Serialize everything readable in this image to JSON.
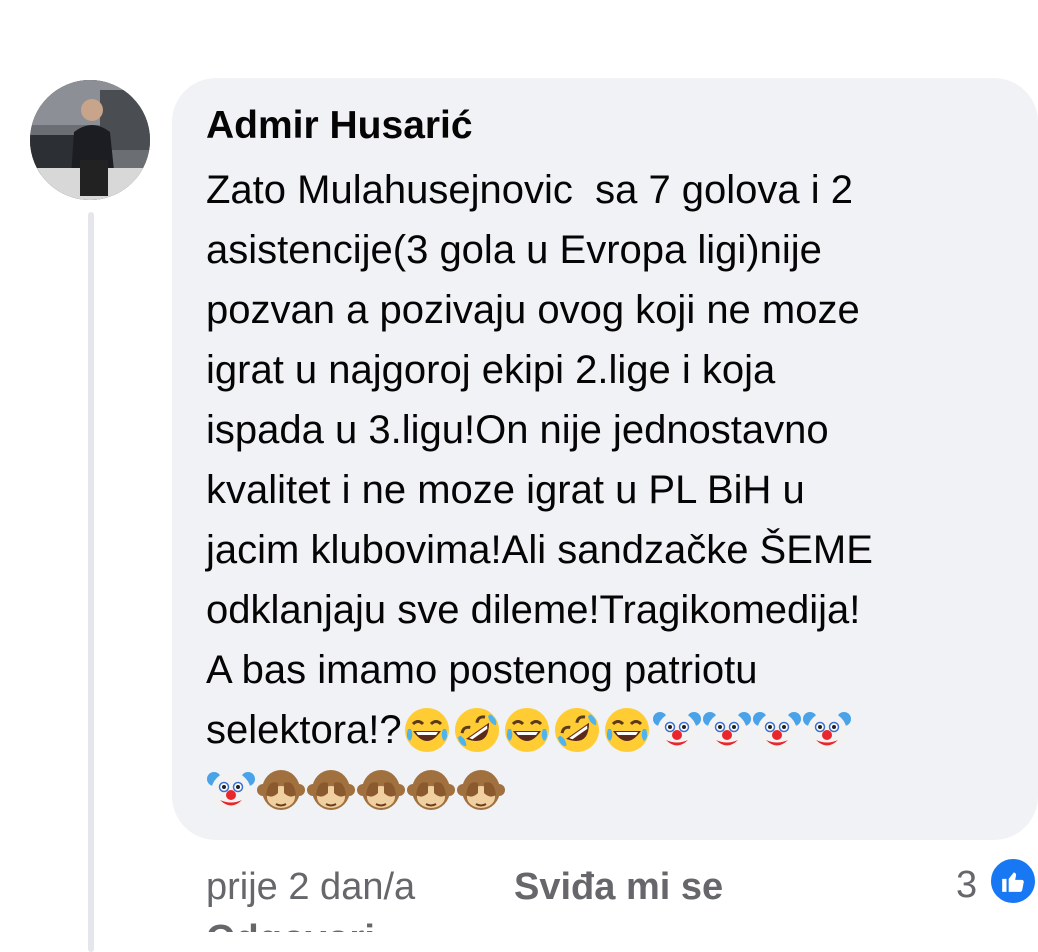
{
  "comment": {
    "author": "Admir Husarić",
    "lines": [
      "Zato Mulahusejnovic  sa 7 golova i 2",
      "asistencije(3 gola u Evropa ligi)nije",
      "pozvan a pozivaju ovog koji ne moze",
      "igrat u najgoroj ekipi 2.lige i koja",
      "ispada u 3.ligu!On nije jednostavno",
      "kvalitet i ne moze igrat u PL BiH u",
      "jacim klubovima!Ali sandzačke ŠEME",
      "odklanjaju sve dileme!Tragikomedija!",
      "A bas imamo postenog patriotu",
      "selektora!?"
    ],
    "emoji_line_1": [
      "laughing",
      "rofl",
      "laughing",
      "rofl",
      "laughing",
      "clown",
      "clown",
      "clown",
      "clown"
    ],
    "emoji_line_2": [
      "clown",
      "see-no-evil",
      "see-no-evil",
      "see-no-evil",
      "see-no-evil",
      "see-no-evil"
    ]
  },
  "meta": {
    "time": "prije 2 dan/a",
    "like_label": "Sviđa mi se",
    "like_count": "3",
    "reply_label": "Odgovori"
  },
  "colors": {
    "bubble": "#f0f2f5",
    "text": "#050505",
    "meta": "#65676b",
    "like_blue": "#1877f2"
  }
}
